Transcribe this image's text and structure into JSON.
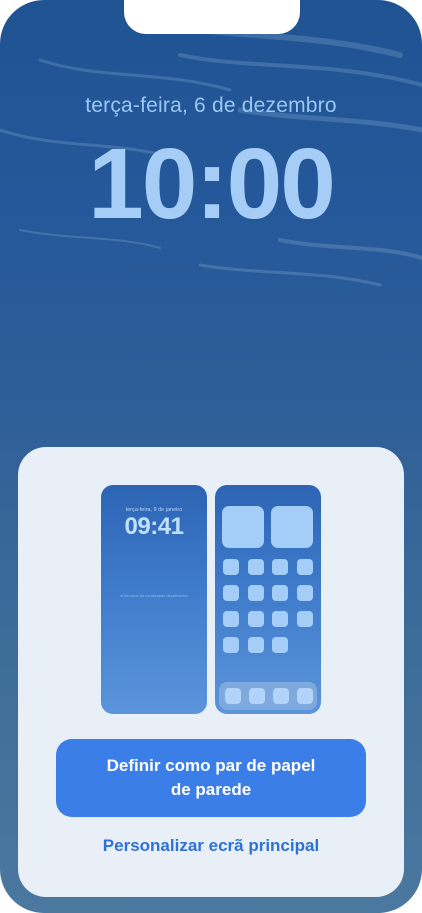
{
  "lock_screen": {
    "date": "terça-feira, 6 de dezembro",
    "time": "10:00"
  },
  "sheet": {
    "lock_preview": {
      "date": "terça-feira, 9 de janeiro",
      "time": "09:41",
      "location_text": "◂ Serviços de localização desativados"
    },
    "home_preview": {
      "widget_count": 2,
      "app_rows": 4,
      "dock_apps": 4
    },
    "primary_button_label": "Definir como par de papel de parede",
    "secondary_link_label": "Personalizar ecrã principal"
  },
  "colors": {
    "accent": "#3b7ee8",
    "link": "#2d71d9",
    "sheet_background": "#e9eff6"
  }
}
